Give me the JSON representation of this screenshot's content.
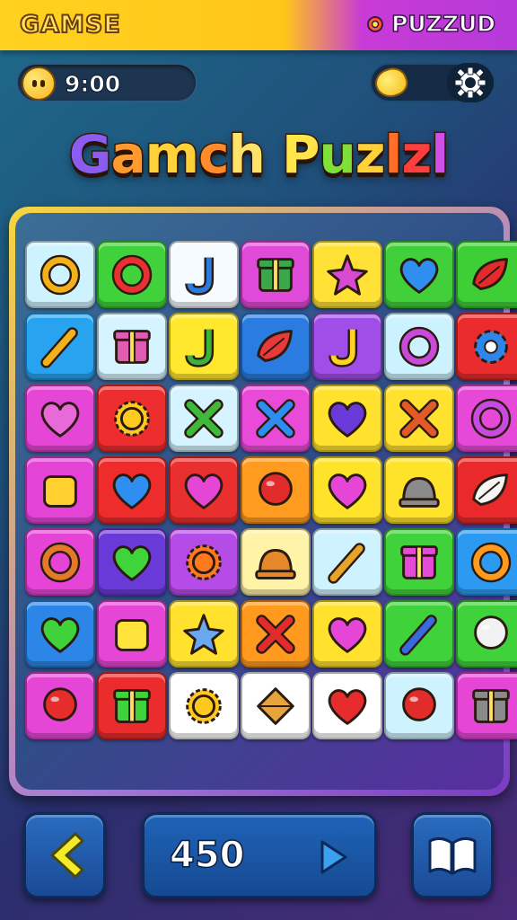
{
  "header": {
    "left_label": "GAMSE",
    "right_label": "PUZZUD"
  },
  "stats": {
    "timer": "9:00",
    "timer_icon": "smiley-face-icon",
    "coin_icon": "lemon-coin-icon",
    "settings_icon": "settings-gear-icon"
  },
  "title": {
    "text": "Gamch Puzlzl",
    "letters": [
      {
        "ch": "G",
        "color": "#8a5cf0"
      },
      {
        "ch": "a",
        "color": "#ff9a2e"
      },
      {
        "ch": "m",
        "color": "#ffd23a"
      },
      {
        "ch": "c",
        "color": "#ff8b2a"
      },
      {
        "ch": "h",
        "color": "#ffe26a"
      },
      {
        "ch": " ",
        "color": "#ffffff"
      },
      {
        "ch": "P",
        "color": "#ffe44a"
      },
      {
        "ch": "u",
        "color": "#7fe03a"
      },
      {
        "ch": "z",
        "color": "#ffd23a"
      },
      {
        "ch": "l",
        "color": "#ff6f2a"
      },
      {
        "ch": "z",
        "color": "#ff3f3f"
      },
      {
        "ch": "l",
        "color": "#d04fe8"
      }
    ]
  },
  "board": {
    "rows": 7,
    "cols": 7,
    "tiles": [
      {
        "color": "#cff2ff",
        "icon": "speech-bubble-icon",
        "glyph": "ring",
        "fg": "#f4b018"
      },
      {
        "color": "#3fd23a",
        "icon": "ring-icon",
        "glyph": "ring",
        "fg": "#e83030"
      },
      {
        "color": "#f5fbff",
        "icon": "music-note-icon",
        "glyph": "hook",
        "fg": "#2a7be0"
      },
      {
        "color": "#e04ad8",
        "icon": "gift-box-icon",
        "glyph": "box",
        "fg": "#3aa84a"
      },
      {
        "color": "#ffe235",
        "icon": "flower-icon",
        "glyph": "star",
        "fg": "#d84ad0"
      },
      {
        "color": "#42d03a",
        "icon": "heart-icon",
        "glyph": "heart",
        "fg": "#2f8ff0"
      },
      {
        "color": "#3ecf36",
        "icon": "leaf-icon",
        "glyph": "leaf",
        "fg": "#e42a2a"
      },
      {
        "color": "#27a3f0",
        "icon": "pencil-icon",
        "glyph": "stick",
        "fg": "#f3b21a"
      },
      {
        "color": "#d6f4ff",
        "icon": "toy-truck-icon",
        "glyph": "box",
        "fg": "#e25bb2"
      },
      {
        "color": "#ffe82e",
        "icon": "check-hook-icon",
        "glyph": "hook",
        "fg": "#39b33a"
      },
      {
        "color": "#2b7ce0",
        "icon": "shoe-icon",
        "glyph": "leaf",
        "fg": "#e83a3a"
      },
      {
        "color": "#a14ee8",
        "icon": "hook-icon",
        "glyph": "hook",
        "fg": "#ffd223"
      },
      {
        "color": "#cdf2ff",
        "icon": "number-six-icon",
        "glyph": "ring",
        "fg": "#c84ad8"
      },
      {
        "color": "#ea2c2c",
        "icon": "gear-icon",
        "glyph": "gear",
        "fg": "#2f86e8"
      },
      {
        "color": "#e646d6",
        "icon": "heart-outline-icon",
        "glyph": "heart",
        "fg": "#e76ad8"
      },
      {
        "color": "#ee2e2e",
        "icon": "sun-icon",
        "glyph": "sun",
        "fg": "#ffca1f"
      },
      {
        "color": "#d6f4ff",
        "icon": "cross-icon",
        "glyph": "cross",
        "fg": "#3fb93a"
      },
      {
        "color": "#e94bd8",
        "icon": "crossed-swords-icon",
        "glyph": "cross",
        "fg": "#2f8cf0"
      },
      {
        "color": "#ffe12e",
        "icon": "heart-icon",
        "glyph": "heart",
        "fg": "#6a3ad8"
      },
      {
        "color": "#ffe12e",
        "icon": "crossed-tools-icon",
        "glyph": "cross",
        "fg": "#e25a28"
      },
      {
        "color": "#e648d8",
        "icon": "ribbon-icon",
        "glyph": "ring",
        "fg": "#c94ae0"
      },
      {
        "color": "#e444d6",
        "icon": "paper-tag-icon",
        "glyph": "square",
        "fg": "#ffd030"
      },
      {
        "color": "#ee2c2c",
        "icon": "heart-icon",
        "glyph": "heart",
        "fg": "#2f8ff0"
      },
      {
        "color": "#ea2f2f",
        "icon": "heart-icon",
        "glyph": "heart",
        "fg": "#e646d6"
      },
      {
        "color": "#ff9b1e",
        "icon": "balloon-icon",
        "glyph": "ball",
        "fg": "#e22c2c"
      },
      {
        "color": "#ffe22a",
        "icon": "heart-icon",
        "glyph": "heart",
        "fg": "#e646d6"
      },
      {
        "color": "#ffe22a",
        "icon": "helmet-icon",
        "glyph": "dome",
        "fg": "#8a8a8a"
      },
      {
        "color": "#ea2a2a",
        "icon": "sock-icon",
        "glyph": "leaf",
        "fg": "#f5f5f5"
      },
      {
        "color": "#e644d6",
        "icon": "pretzel-icon",
        "glyph": "ring",
        "fg": "#e27a2a"
      },
      {
        "color": "#6a3ad8",
        "icon": "heart-icon",
        "glyph": "heart",
        "fg": "#3fd43a"
      },
      {
        "color": "#b54ce8",
        "icon": "sun-icon",
        "glyph": "sun",
        "fg": "#ff7a1e"
      },
      {
        "color": "#fff3a8",
        "icon": "basket-icon",
        "glyph": "dome",
        "fg": "#e6882a"
      },
      {
        "color": "#cff2ff",
        "icon": "brush-icon",
        "glyph": "stick",
        "fg": "#e8a42a"
      },
      {
        "color": "#3fd23a",
        "icon": "gift-bag-icon",
        "glyph": "box",
        "fg": "#e64ad8"
      },
      {
        "color": "#2b9af0",
        "icon": "spiral-candy-icon",
        "glyph": "ring",
        "fg": "#ff9a1e"
      },
      {
        "color": "#2b86e8",
        "icon": "heart-icon",
        "glyph": "heart",
        "fg": "#3fd23a"
      },
      {
        "color": "#e646d6",
        "icon": "cheese-icon",
        "glyph": "square",
        "fg": "#ffe23a"
      },
      {
        "color": "#ffe12e",
        "icon": "puzzle-piece-icon",
        "glyph": "star",
        "fg": "#6aa8f0"
      },
      {
        "color": "#ff9a1e",
        "icon": "bandage-icon",
        "glyph": "cross",
        "fg": "#e22c2c"
      },
      {
        "color": "#ffe12e",
        "icon": "heart-icon",
        "glyph": "heart",
        "fg": "#e646d6"
      },
      {
        "color": "#3fd23a",
        "icon": "hammer-icon",
        "glyph": "stick",
        "fg": "#3a6ae0"
      },
      {
        "color": "#3fd23a",
        "icon": "ice-cream-icon",
        "glyph": "ball",
        "fg": "#f2f2f2"
      },
      {
        "color": "#e646d6",
        "icon": "strawberry-icon",
        "glyph": "ball",
        "fg": "#e62c2c"
      },
      {
        "color": "#ea2c2c",
        "icon": "camera-box-icon",
        "glyph": "box",
        "fg": "#3fd23a"
      },
      {
        "color": "#ffffff",
        "icon": "medal-icon",
        "glyph": "sun",
        "fg": "#ffc81e"
      },
      {
        "color": "#ffffff",
        "icon": "envelope-icon",
        "glyph": "diamond",
        "fg": "#e6a43a"
      },
      {
        "color": "#ffffff",
        "icon": "heart-icon",
        "glyph": "heart",
        "fg": "#e62c2c"
      },
      {
        "color": "#cff2ff",
        "icon": "red-button-icon",
        "glyph": "ball",
        "fg": "#e22c2c"
      },
      {
        "color": "#e646d6",
        "icon": "camera-icon",
        "glyph": "box",
        "fg": "#8a8a8a"
      }
    ]
  },
  "controls": {
    "back_icon": "chevron-left-icon",
    "score": "450",
    "play_icon": "play-arrow-icon",
    "book_icon": "open-book-icon"
  }
}
